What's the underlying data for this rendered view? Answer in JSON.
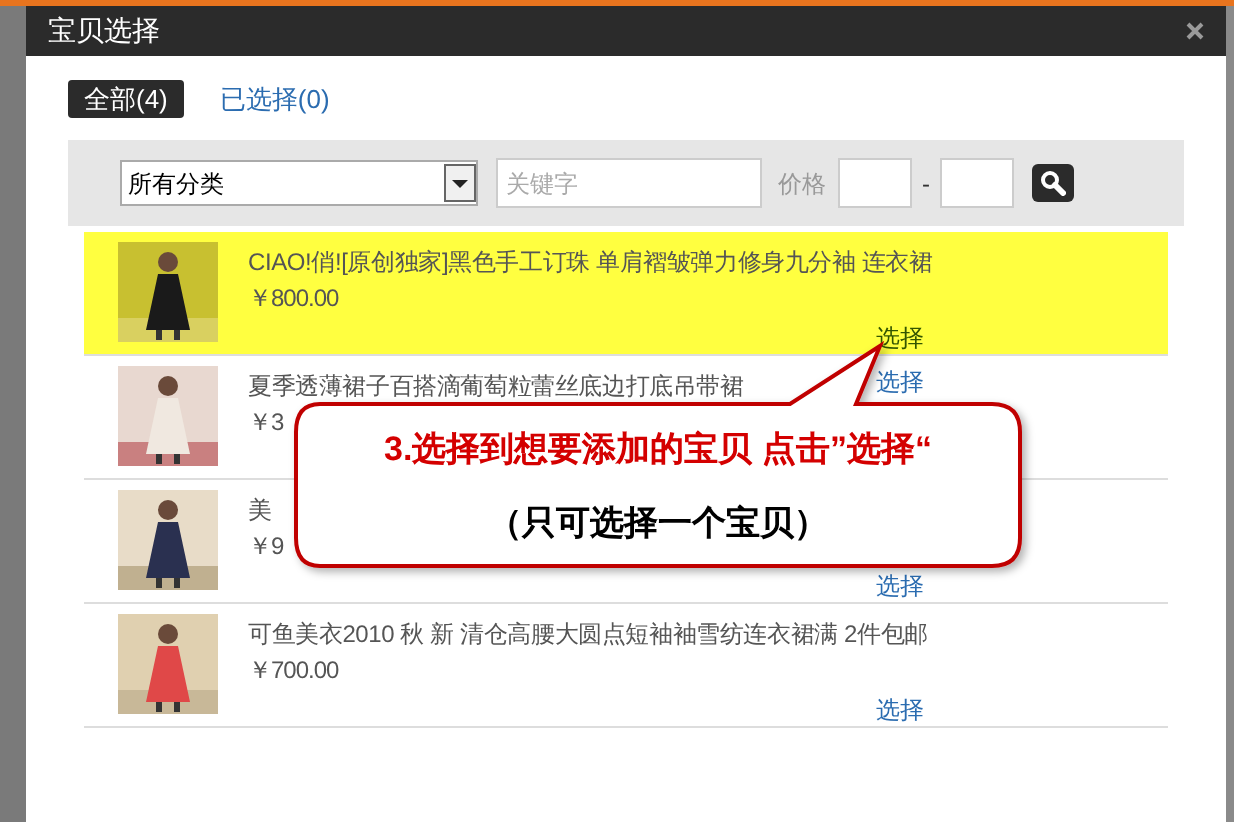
{
  "window": {
    "title": "宝贝选择"
  },
  "tabs": [
    {
      "label": "全部(4)",
      "selected": true
    },
    {
      "label": "已选择(0)",
      "selected": false
    }
  ],
  "filter": {
    "category": "所有分类",
    "keyword_placeholder": "关键字",
    "price_label": "价格",
    "price_separator": "-"
  },
  "items": [
    {
      "title": "CIAO!俏![原创独家]黑色手工订珠 单肩褶皱弹力修身九分袖 连衣裙",
      "price": "￥800.00",
      "action": "选择",
      "selected": true,
      "action_at_top": false
    },
    {
      "title": "夏季透薄裙子百搭滴葡萄粒蕾丝底边打底吊带裙",
      "price": "￥3",
      "action": "选择",
      "selected": false,
      "action_at_top": true
    },
    {
      "title": "美",
      "price": "￥9",
      "action": "选择",
      "selected": false,
      "action_at_top": false
    },
    {
      "title": "可鱼美衣2010 秋 新 清仓高腰大圆点短袖袖雪纺连衣裙满 2件包邮",
      "price": "￥700.00",
      "action": "选择",
      "selected": false,
      "action_at_top": false
    }
  ],
  "callout": {
    "line_1": "3.选择到想要添加的宝贝 点击”选择“",
    "line_2": "（只可选择一个宝贝）"
  }
}
